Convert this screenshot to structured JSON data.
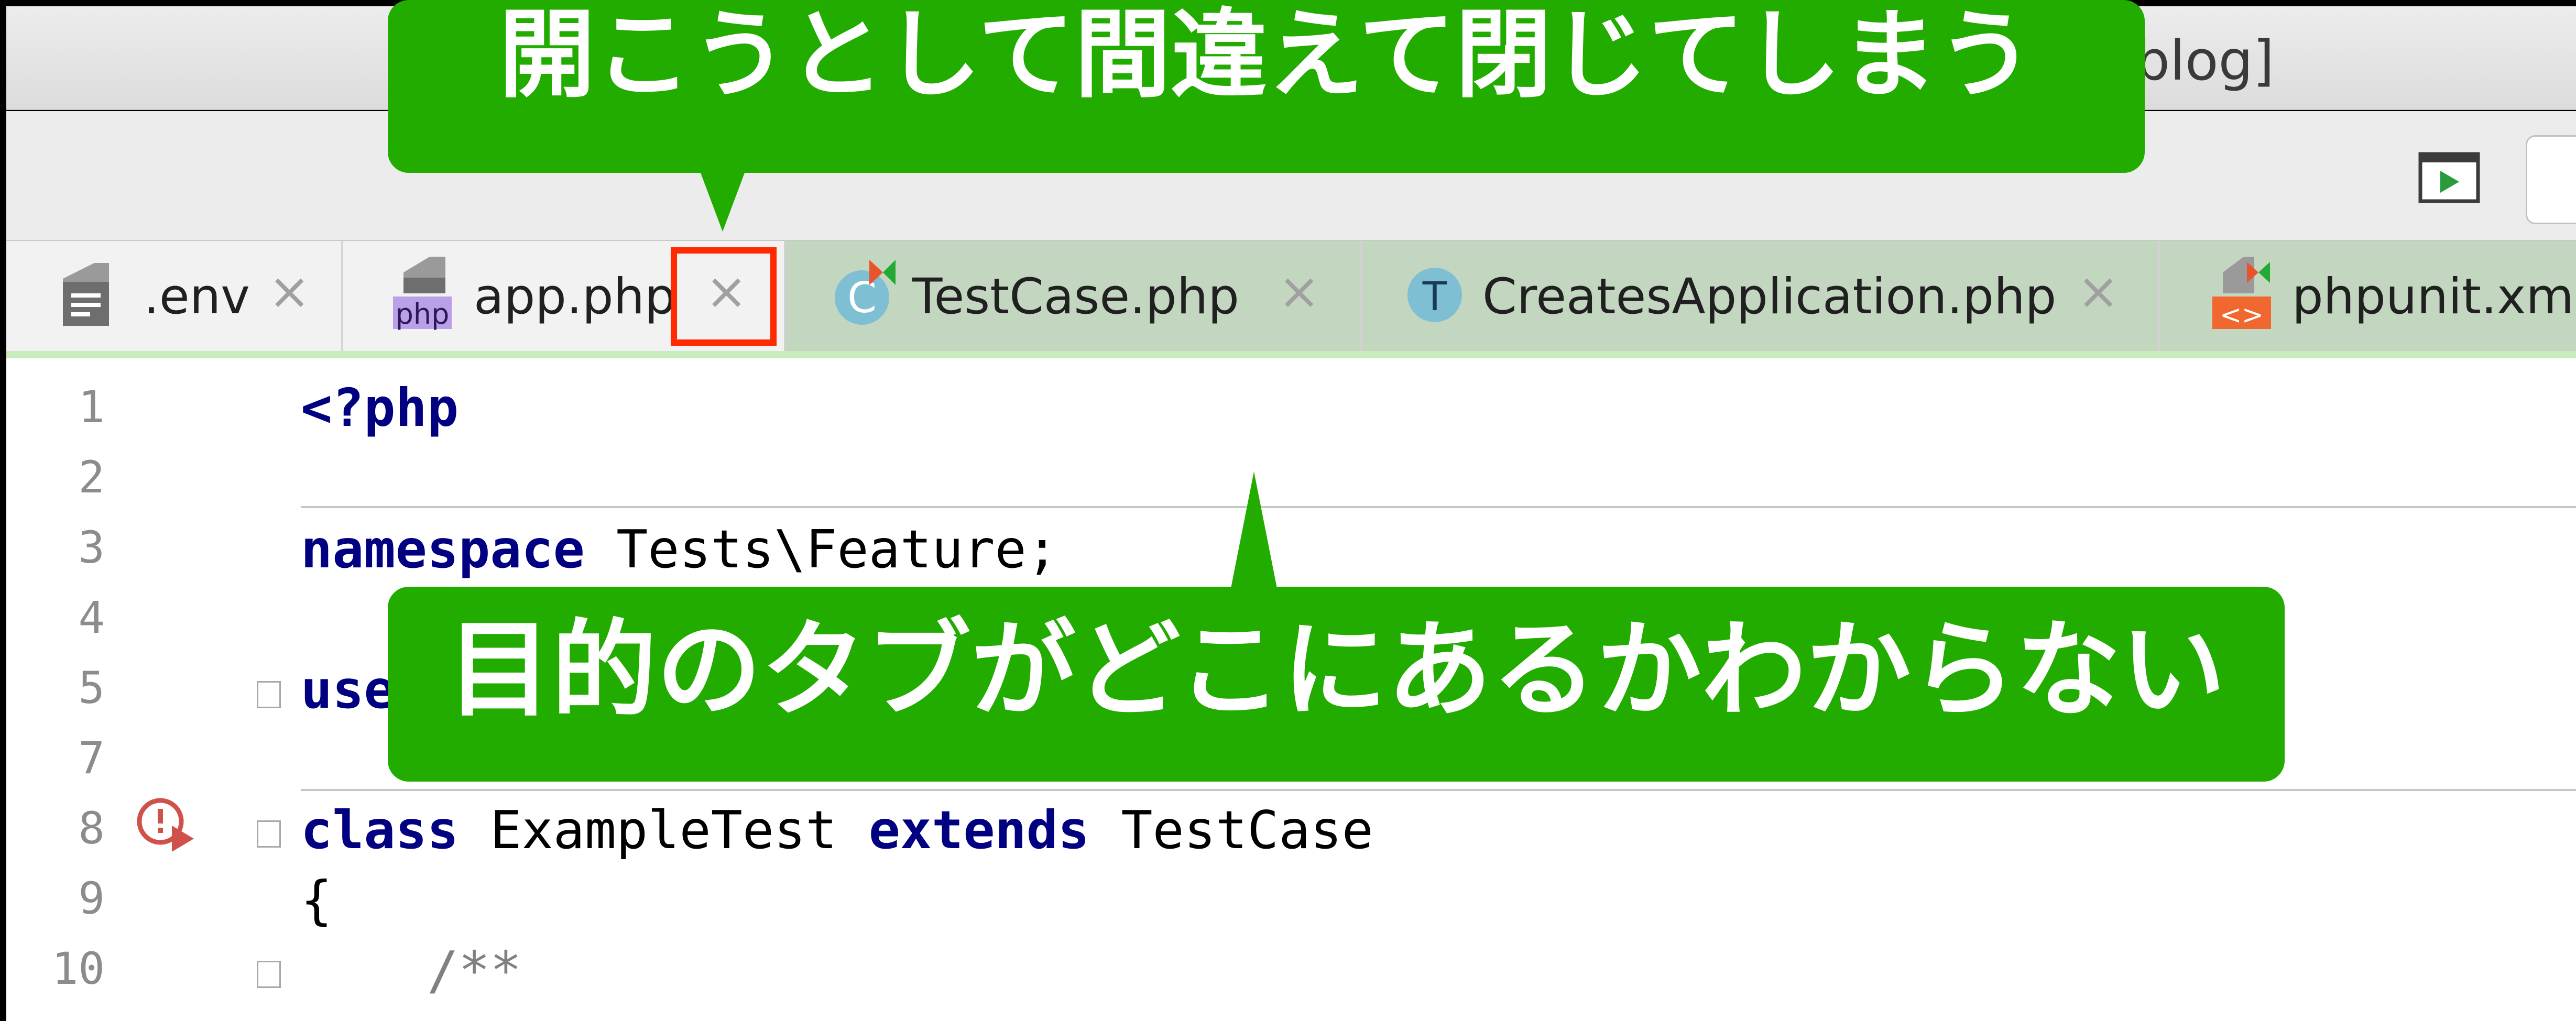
{
  "window": {
    "title": "blog]"
  },
  "tabs": [
    {
      "label": ".env",
      "icon": "text-file-icon",
      "close": "×"
    },
    {
      "label": "app.php",
      "icon": "php-file-icon",
      "close": "×"
    },
    {
      "label": "TestCase.php",
      "icon": "class-file-icon",
      "close": "×"
    },
    {
      "label": "CreatesApplication.php",
      "icon": "trait-file-icon",
      "close": "×"
    },
    {
      "label": "phpunit.xml",
      "icon": "xml-file-icon"
    }
  ],
  "editor": {
    "lines": [
      {
        "n": "1"
      },
      {
        "n": "2"
      },
      {
        "n": "3"
      },
      {
        "n": "4"
      },
      {
        "n": "5"
      },
      {
        "n": "7"
      },
      {
        "n": "8"
      },
      {
        "n": "9"
      },
      {
        "n": "10"
      }
    ],
    "code": {
      "php_open": "<?php",
      "namespace_kw": "namespace",
      "namespace_val": " Tests\\Feature;",
      "use_kw": "use",
      "class_kw": "class",
      "class_name": " ExampleTest ",
      "extends_kw": "extends",
      "parent": " TestCase",
      "brace": "{",
      "comment": "    /**"
    }
  },
  "callouts": {
    "top": "開こうとして間違えて閉じてしまう",
    "middle": "目的のタブがどこにあるかわからない"
  },
  "colors": {
    "callout": "#22ac00",
    "highlight": "#ff2a00",
    "keyword": "#000080"
  }
}
